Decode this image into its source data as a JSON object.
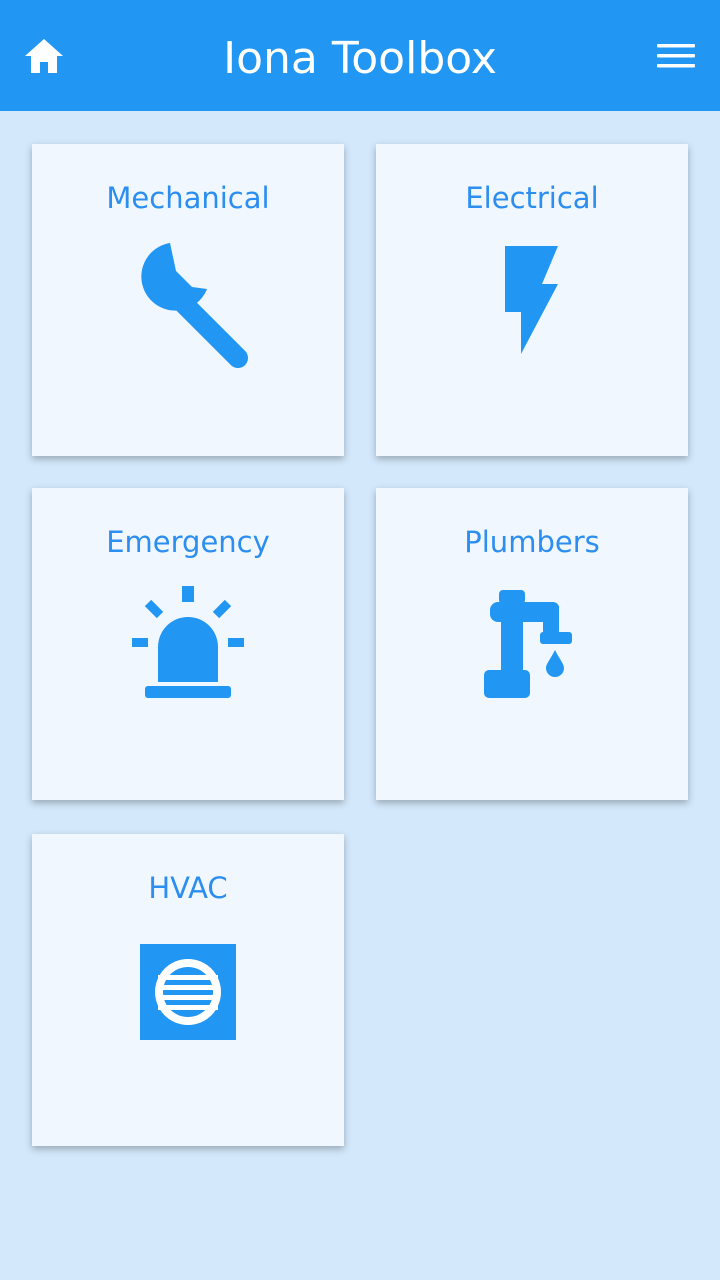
{
  "header": {
    "title": "Iona Toolbox",
    "home_icon": "home-icon",
    "menu_icon": "hamburger-menu-icon",
    "background": "#2196f3"
  },
  "tiles": [
    {
      "label": "Mechanical",
      "icon": "wrench-icon"
    },
    {
      "label": "Electrical",
      "icon": "lightning-bolt-icon"
    },
    {
      "label": "Emergency",
      "icon": "alarm-light-icon"
    },
    {
      "label": "Plumbers",
      "icon": "water-tap-icon"
    },
    {
      "label": "HVAC",
      "icon": "air-vent-icon"
    }
  ],
  "colors": {
    "accent": "#2196f3",
    "page_background": "#d3e8fb",
    "tile_background": "#f0f7fe",
    "tile_text": "#2b8ef0"
  }
}
